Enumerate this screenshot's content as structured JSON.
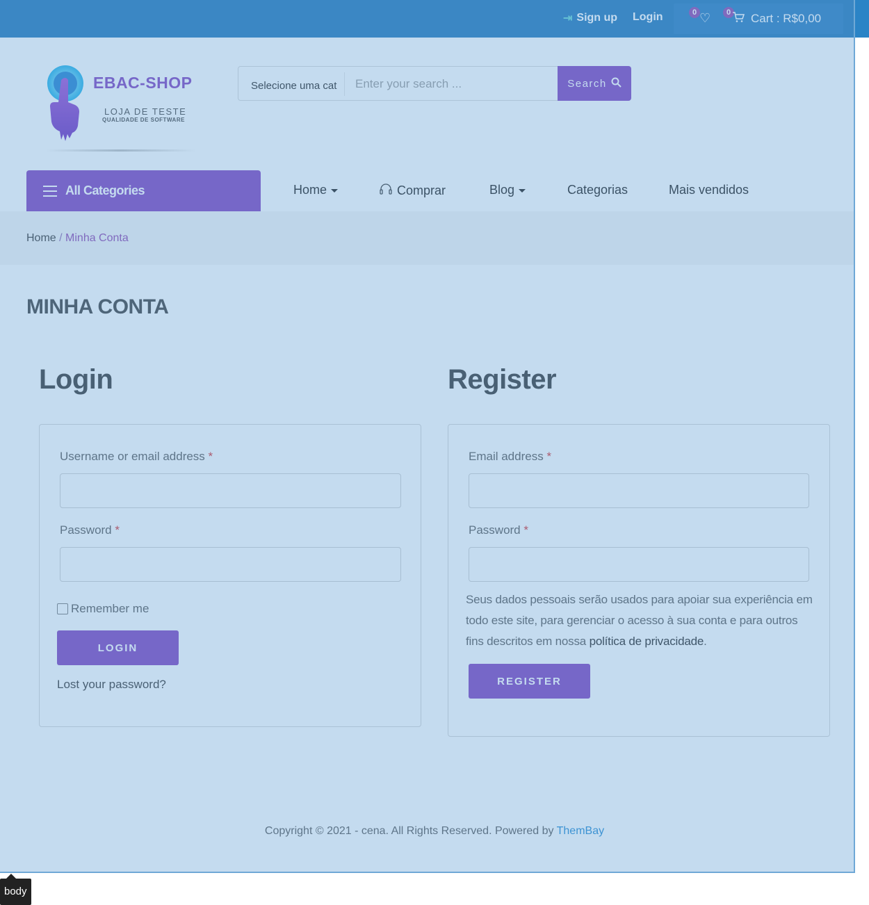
{
  "topbar": {
    "signup_label": "Sign up",
    "login_label": "Login",
    "wishlist_count": "0",
    "cart_count": "0",
    "cart_label": "Cart : R$0,00"
  },
  "header": {
    "brand": "EBAC-SHOP",
    "tagline": "LOJA DE TESTE",
    "subtagline": "QUALIDADE DE SOFTWARE",
    "search": {
      "category": "Selecione uma cat",
      "placeholder": "Enter your search ...",
      "button_label": "Search"
    }
  },
  "nav": {
    "all_categories": "All Categories",
    "items": [
      {
        "label": "Home"
      },
      {
        "label": "Comprar"
      },
      {
        "label": "Blog"
      },
      {
        "label": "Categorias"
      },
      {
        "label": "Mais vendidos"
      }
    ]
  },
  "breadcrumb": {
    "home": "Home",
    "separator": " / ",
    "current": "Minha Conta"
  },
  "page_title": "MINHA CONTA",
  "login": {
    "heading": "Login",
    "username_label": "Username or email address",
    "password_label": "Password",
    "required_mark": "*",
    "remember_label": "Remember me",
    "button_label": "LOGIN",
    "lost_password": "Lost your password?"
  },
  "register": {
    "heading": "Register",
    "email_label": "Email address",
    "password_label": "Password",
    "required_mark": "*",
    "privacy_text": "Seus dados pessoais serão usados para apoiar sua experiência em todo este site, para gerenciar o acesso à sua conta e para outros fins descritos em nossa ",
    "privacy_link": "política de privacidade",
    "privacy_end": ".",
    "button_label": "REGISTER"
  },
  "footer": {
    "copyright": "Copyright © 2021 - cena. All Rights Reserved. Powered by ",
    "powered_link": "ThemBay"
  },
  "devtools": {
    "element_tag": "body"
  },
  "colors": {
    "accent": "#7d3fbf",
    "topbar": "#1b74b8",
    "overlay": "#6ba5d6",
    "required": "#d62c2c",
    "link": "#1f87d0"
  }
}
